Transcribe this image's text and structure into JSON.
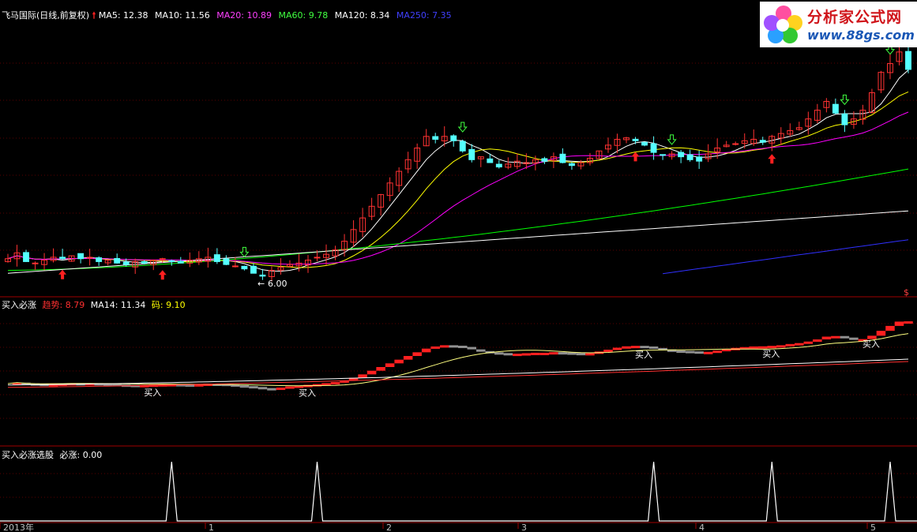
{
  "colors": {
    "up": "#ff3232",
    "down": "#54ffff",
    "ma5": "#ffffff",
    "ma10": "#ffff00",
    "ma20": "#ff00ff",
    "ma60": "#00ff00",
    "ma120": "#ffffff",
    "ma250": "#3030ff",
    "divider": "#a00000",
    "grid": "#5a0000",
    "buy_red": "#ff2020",
    "buy_grey": "#909090",
    "signal": "#ffffff"
  },
  "header": {
    "title": "飞马国际(日线,前复权)",
    "ma5": "MA5: 12.38",
    "ma10": "MA10: 11.56",
    "ma20": "MA20: 10.89",
    "ma60": "MA60: 9.78",
    "ma120": "MA120: 8.34",
    "ma250": "MA250: 7.35"
  },
  "panel2": {
    "name": "买入必涨",
    "trend": "趋势: 8.79",
    "ma14": "MA14: 11.34",
    "code": "码: 9.10"
  },
  "panel3": {
    "name": "买入必涨选股",
    "value": "必涨: 0.00"
  },
  "low_label": "6.00",
  "buy_text": "买入",
  "right_marker": "$",
  "x_labels": [
    "2013年",
    "1",
    "2",
    "3",
    "4",
    "5"
  ],
  "logo": {
    "name": "分析家公式网",
    "url": "www.88gs.com",
    "icon": "flower-icon"
  },
  "chart_data": [
    {
      "type": "candlestick",
      "title": "飞马国际(日线,前复权)",
      "low_annotation": 6.0,
      "series": [
        {
          "name": "MA5",
          "value": 12.38
        },
        {
          "name": "MA10",
          "value": 11.56
        },
        {
          "name": "MA20",
          "value": 10.89
        },
        {
          "name": "MA60",
          "value": 9.78
        },
        {
          "name": "MA120",
          "value": 8.34
        },
        {
          "name": "MA250",
          "value": 7.35
        }
      ],
      "closes": [
        6.7,
        6.9,
        6.6,
        6.55,
        6.65,
        6.75,
        6.7,
        6.8,
        6.7,
        6.75,
        6.6,
        6.65,
        6.55,
        6.5,
        6.6,
        6.55,
        6.65,
        6.7,
        6.6,
        6.55,
        6.65,
        6.7,
        6.75,
        6.6,
        6.5,
        6.45,
        6.35,
        6.2,
        6.1,
        6.3,
        6.4,
        6.5,
        6.55,
        6.65,
        6.75,
        6.85,
        7.0,
        7.3,
        7.7,
        8.1,
        8.5,
        8.9,
        9.3,
        9.7,
        10.1,
        10.5,
        10.9,
        10.8,
        10.9,
        10.75,
        10.4,
        10.1,
        10.2,
        10.0,
        9.85,
        9.95,
        10.05,
        10.0,
        10.1,
        10.05,
        10.2,
        10.0,
        9.9,
        10.0,
        10.15,
        10.4,
        10.6,
        10.8,
        10.85,
        10.75,
        10.6,
        10.35,
        10.25,
        10.3,
        10.2,
        10.1,
        10.05,
        10.3,
        10.5,
        10.6,
        10.65,
        10.75,
        10.8,
        10.7,
        10.9,
        11.0,
        11.1,
        11.2,
        11.5,
        11.8,
        12.1,
        11.7,
        11.3,
        11.5,
        11.8,
        12.4,
        13.1,
        13.4,
        13.8,
        13.2
      ],
      "buy_arrows_at_index": [
        6,
        17,
        69,
        84
      ],
      "sell_arrows_at_index": [
        26,
        50,
        73,
        92,
        97
      ]
    },
    {
      "type": "line",
      "title": "买入必涨",
      "series": [
        {
          "name": "趋势",
          "value": 8.79
        },
        {
          "name": "MA14",
          "value": 11.34
        },
        {
          "name": "码",
          "value": 9.1
        }
      ],
      "annotations": [
        "买入",
        "买入",
        "买入",
        "买入",
        "买入"
      ]
    },
    {
      "type": "line",
      "title": "买入必涨选股",
      "series": [
        {
          "name": "必涨",
          "value": 0.0
        }
      ],
      "signal_indices": [
        18,
        34,
        71,
        84,
        97
      ]
    }
  ]
}
